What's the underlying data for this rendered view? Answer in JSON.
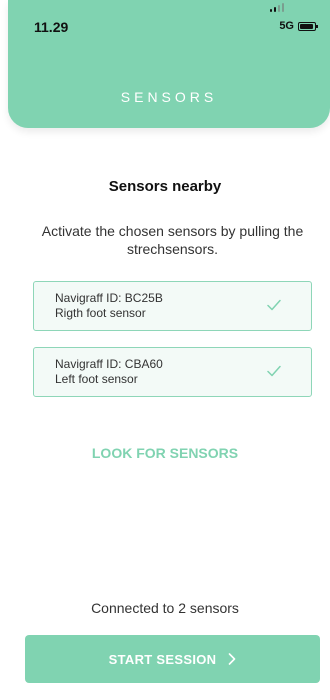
{
  "status_bar": {
    "time": "11.29",
    "network": "5G"
  },
  "header": {
    "title": "SENSORS"
  },
  "main": {
    "title": "Sensors nearby",
    "description": "Activate the chosen sensors by pulling the strechsensors.",
    "sensors": [
      {
        "id_text": "Navigraff ID: BC25B",
        "name": "Rigth foot sensor",
        "icon": "check-icon"
      },
      {
        "id_text": "Navigraff ID: CBA60",
        "name": "Left foot sensor",
        "icon": "check-icon"
      }
    ],
    "look_link": "LOOK FOR SENSORS",
    "connected_text": "Connected to 2 sensors",
    "start_button": "START SESSION"
  },
  "colors": {
    "accent": "#80d3b1",
    "card_background": "#f3faf7",
    "card_border": "#8ed6b8"
  }
}
